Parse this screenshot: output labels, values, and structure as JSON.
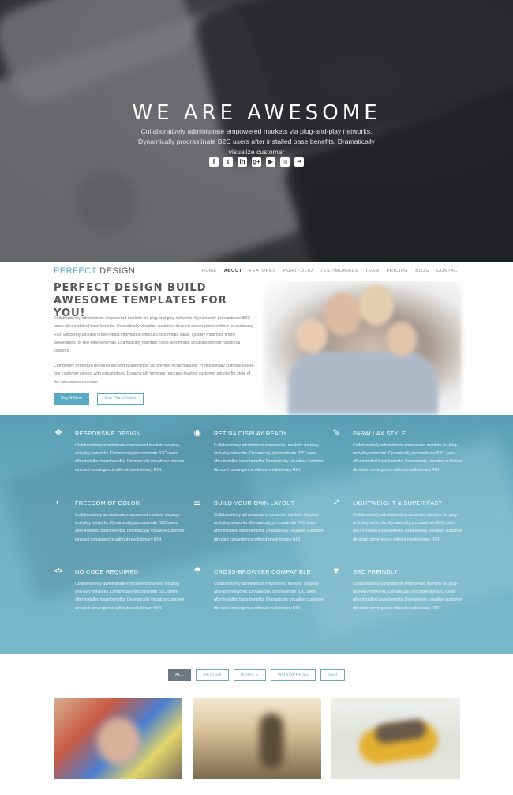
{
  "hero": {
    "title": "WE ARE AWESOME",
    "subtitle": "Collaboratively administrate empowered markets via plug-and-play networks. Dynamically procrastinate B2C users after installed base benefits. Dramatically visualize customer",
    "social": [
      {
        "icon": "facebook-icon",
        "glyph": "f"
      },
      {
        "icon": "twitter-icon",
        "glyph": "t"
      },
      {
        "icon": "linkedin-icon",
        "glyph": "in"
      },
      {
        "icon": "google-plus-icon",
        "glyph": "g+"
      },
      {
        "icon": "youtube-icon",
        "glyph": "▶"
      },
      {
        "icon": "instagram-icon",
        "glyph": "◎"
      },
      {
        "icon": "flickr-icon",
        "glyph": "••"
      }
    ]
  },
  "nav": {
    "brand_part1": "PERFECT",
    "brand_part2": "DESIGN",
    "items": [
      "HOME",
      "ABOUT",
      "FEATURES",
      "PORTFOLIO",
      "TESTIMONIALS",
      "TEAM",
      "PRICING",
      "BLOG",
      "CONTACT"
    ],
    "active": "ABOUT"
  },
  "about": {
    "title": "PERFECT DESIGN BUILD AWESOME TEMPLATES FOR YOU!",
    "para1": "Collaboratively administrate empowered markets via plug-and-play networks. Dynamically procrastinate B2C users after installed base benefits. Dramatically visualize customer directed convergence without revolutionary ROI. Efficiently unleash cross-media information without cross-media value. Quickly maximize timely deliverables for real-time schemas. Dramatically maintain clicks-and-mortar solutions without functional solutions.",
    "para2": "Completely synergize resource sucking relationships via premier niche markets. Professionally cultivate one-to-one customer service with robust ideas. Dynamically innovate resource-leveling customer service for state of the art customer service.",
    "btn_primary": "Buy It Now",
    "btn_secondary": "See Pro Version"
  },
  "features": [
    {
      "icon": "move-arrows-icon",
      "glyph": "✥",
      "title": "RESPONSIVE DESIGN",
      "desc": "Collaboratively administrate empowered markets via plug-and-play networks. Dynamically procrastinate B2C users after installed base benefits. Dramatically visualize customer directed convergence without revolutionary ROI."
    },
    {
      "icon": "eye-icon",
      "glyph": "◉",
      "title": "RETINA DISPLAY READY",
      "desc": "Collaboratively administrate empowered markets via plug-and-play networks. Dynamically procrastinate B2C users after installed base benefits. Dramatically visualize customer directed convergence without revolutionary ROI."
    },
    {
      "icon": "magic-wand-icon",
      "glyph": "✎",
      "title": "PARALLAX STYLE",
      "desc": "Collaboratively administrate empowered markets via plug-and-play networks. Dynamically procrastinate B2C users after installed base benefits. Dramatically visualize customer directed convergence without revolutionary ROI."
    },
    {
      "icon": "contrast-icon",
      "glyph": "◐",
      "title": "FREEDOM OF COLOR",
      "desc": "Collaboratively administrate empowered markets via plug-and-play networks. Dynamically procrastinate B2C users after installed base benefits. Dramatically visualize customer directed convergence without revolutionary ROI."
    },
    {
      "icon": "layout-icon",
      "glyph": "☰",
      "title": "BUILD YOUR OWN LAYOUT",
      "desc": "Collaboratively administrate empowered markets via plug-and-play networks. Dynamically procrastinate B2C users after installed base benefits. Dramatically visualize customer directed convergence without revolutionary ROI."
    },
    {
      "icon": "rocket-icon",
      "glyph": "➶",
      "title": "LIGHTWEIGHT & SUPER FAST",
      "desc": "Collaboratively administrate empowered markets via plug-and-play networks. Dynamically procrastinate B2C users after installed base benefits. Dramatically visualize customer directed convergence without revolutionary ROI."
    },
    {
      "icon": "code-icon",
      "glyph": "</>",
      "title": "NO CODE REQUIRED",
      "desc": "Collaboratively administrate empowered markets via plug-and-play networks. Dynamically procrastinate B2C users after installed base benefits. Dramatically visualize customer directed convergence without revolutionary ROI."
    },
    {
      "icon": "umbrella-icon",
      "glyph": "☂",
      "title": "CROSS-BROWSER COMPATIBLE",
      "desc": "Collaboratively administrate empowered markets via plug-and-play networks. Dynamically procrastinate B2C users after installed base benefits. Dramatically visualize customer directed convergence without revolutionary ROI."
    },
    {
      "icon": "filter-icon",
      "glyph": "▼",
      "title": "SEO FREINDLY",
      "desc": "Collaboratively administrate empowered markets via plug-and-play networks. Dynamically procrastinate B2C users after installed base benefits. Dramatically visualize customer directed convergence without revolutionary ROI."
    }
  ],
  "portfolio": {
    "filters": [
      "ALL",
      "DESIGN",
      "MOBILE",
      "WORDPRESS",
      "SEO"
    ],
    "active": "ALL"
  },
  "colors": {
    "accent": "#5aa9c4",
    "features_bg": "#6eb0c3",
    "hero_bg": "#3b3c40"
  }
}
